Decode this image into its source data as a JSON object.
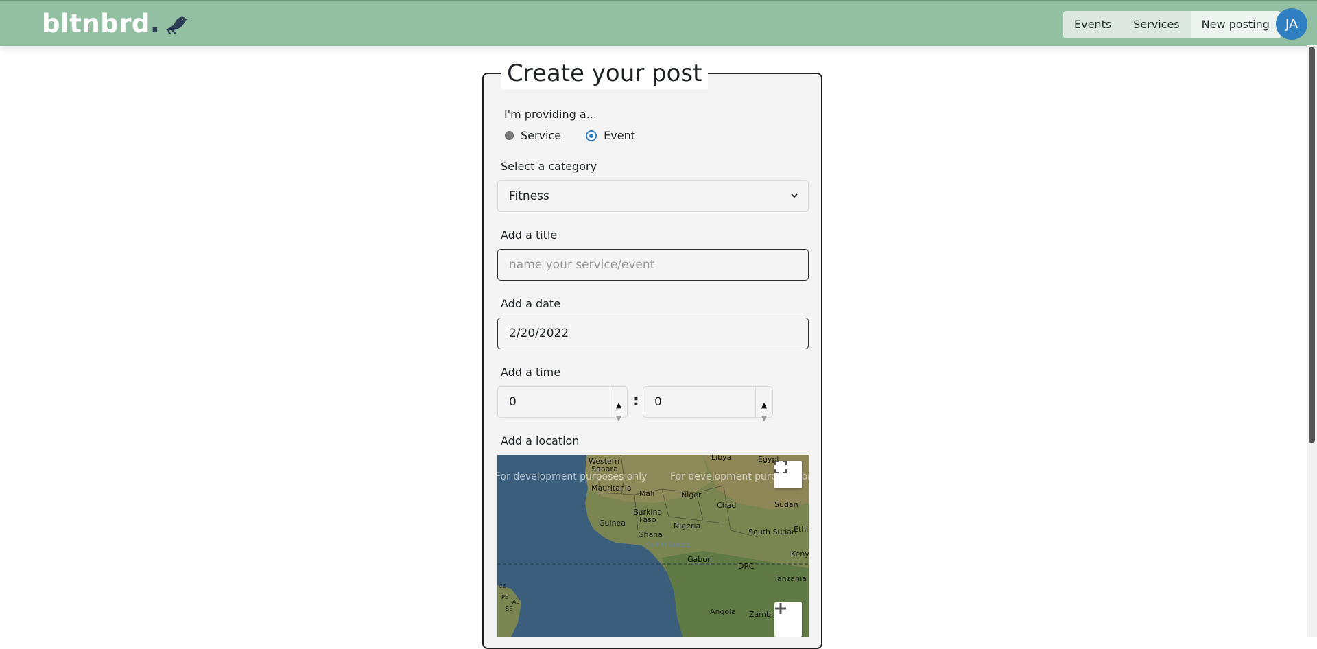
{
  "brand": {
    "name": "bltnbrd",
    "dot": "."
  },
  "nav": {
    "items": [
      "Events",
      "Services",
      "New posting"
    ],
    "active": "New posting"
  },
  "user": {
    "initials": "JA"
  },
  "form": {
    "legend": "Create your post",
    "providing_label": "I'm providing a...",
    "options": [
      "Service",
      "Event"
    ],
    "selected_option": "Event",
    "category_label": "Select a category",
    "category_value": "Fitness",
    "title_label": "Add a title",
    "title_placeholder": "name your service/event",
    "date_label": "Add a date",
    "date_value": "2/20/2022",
    "time_label": "Add a time",
    "time_hours": "0",
    "time_separator": ":",
    "time_minutes": "0",
    "location_label": "Add a location"
  },
  "map": {
    "watermark": "For development purposes only",
    "places": {
      "libya": "Libya",
      "egypt": "Egypt",
      "western_sahara_1": "Western",
      "western_sahara_2": "Sahara",
      "mauritania": "Mauritania",
      "mali": "Mali",
      "niger": "Niger",
      "chad": "Chad",
      "sudan": "Sudan",
      "burkina_1": "Burkina",
      "burkina_2": "Faso",
      "guinea": "Guinea",
      "nigeria": "Nigeria",
      "ghana": "Ghana",
      "south_sudan": "South Sudan",
      "ethiopia": "Ethic",
      "gulf": "Gulf of Guinea",
      "gabon": "Gabon",
      "drc": "DRC",
      "kenya": "Kenya",
      "tanzania": "Tanzania",
      "angola": "Angola",
      "zambia": "Zambia",
      "ce": "CE",
      "pe": "PE",
      "al": "AL",
      "se": "SE"
    }
  },
  "colors": {
    "header": "#93bfa2",
    "accent": "#2f7fc2",
    "ocean": "#3b5e7c",
    "land": "#7a8552"
  },
  "icons": {
    "bird": "bird-logo-icon",
    "chevron": "chevron-down-icon",
    "fullscreen": "fullscreen-icon",
    "zoom_in": "zoom-in-icon"
  }
}
